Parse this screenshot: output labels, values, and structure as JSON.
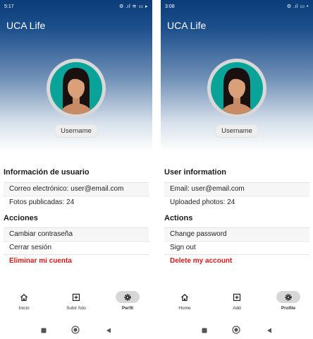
{
  "screens": [
    {
      "status_time": "5:17",
      "status_icons": "⚙ .ıl ≋ ▭ ▸",
      "app_title": "UCA Life",
      "username": "Username",
      "user_section_title": "Información de usuario",
      "email_row": "Correo electrónico: user@email.com",
      "photos_row": "Fotos publicadas: 24",
      "actions_title": "Acciones",
      "change_password": "Cambiar contraseña",
      "sign_out": "Cerrar sesión",
      "delete_account": "Eliminar mi cuenta",
      "nav": [
        {
          "label": "Inicio",
          "icon": "home-icon"
        },
        {
          "label": "Subir foto",
          "icon": "add-box-icon"
        },
        {
          "label": "Perfil",
          "icon": "gear-icon"
        }
      ]
    },
    {
      "status_time": "3:08",
      "status_icons": "⚙ .ıl ▭ •",
      "app_title": "UCA Life",
      "username": "Username",
      "user_section_title": "User information",
      "email_row": "Email: user@email.com",
      "photos_row": "Uploaded photos: 24",
      "actions_title": "Actions",
      "change_password": "Change password",
      "sign_out": "Sign out",
      "delete_account": "Delete my account",
      "nav": [
        {
          "label": "Home",
          "icon": "home-icon"
        },
        {
          "label": "Add",
          "icon": "add-box-icon"
        },
        {
          "label": "Profile",
          "icon": "gear-icon"
        }
      ]
    }
  ],
  "colors": {
    "header_top": "#0b3c7a",
    "danger": "#d11a1a",
    "avatar_bg": "#0aa39a"
  }
}
